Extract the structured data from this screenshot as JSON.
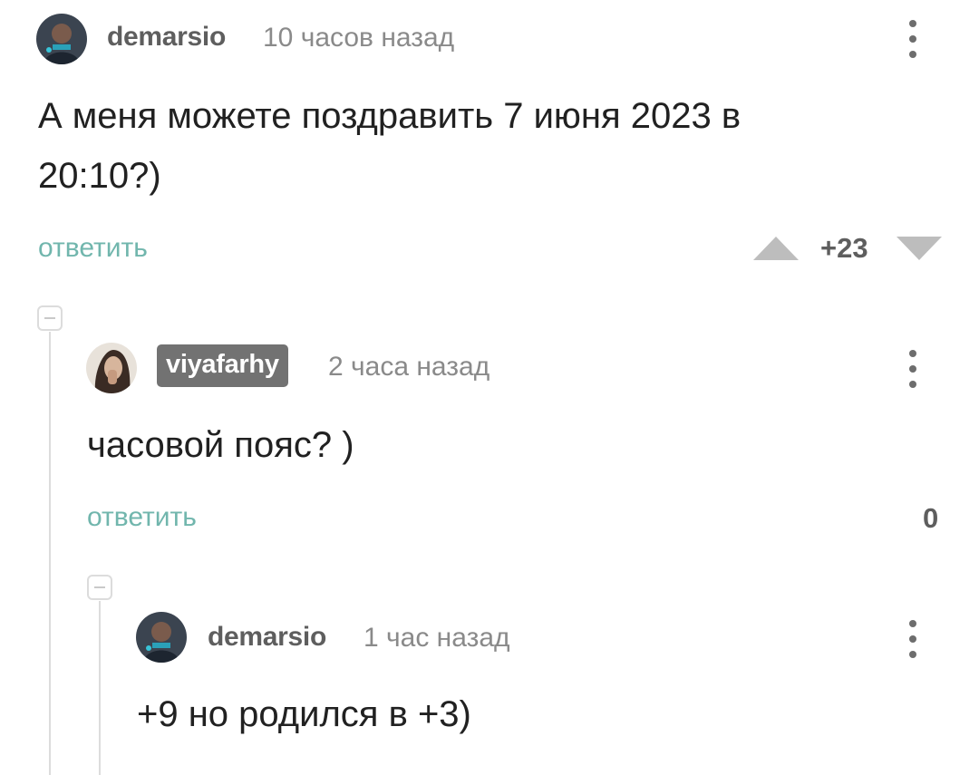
{
  "comments": [
    {
      "username": "demarsio",
      "time": "10 часов назад",
      "text_line1": "А меня можете поздравить 7 июня 2023 в",
      "text_line2": "20:10?)",
      "reply": "ответить",
      "score": "+23"
    },
    {
      "username": "viyafarhy",
      "time": "2 часа назад",
      "text": "часовой пояс? )",
      "reply": "ответить",
      "score": "0"
    },
    {
      "username": "demarsio",
      "time": "1 час назад",
      "text": "+9 но родился в +3)"
    }
  ],
  "icons": {
    "more": "kebab-menu-icon",
    "upvote": "triangle-up-icon",
    "downvote": "triangle-down-icon",
    "collapse": "collapse-minus-icon"
  },
  "colors": {
    "reply_link": "#71b6ad",
    "username_badge": "#727272",
    "thread_line": "#dcdcdc"
  }
}
